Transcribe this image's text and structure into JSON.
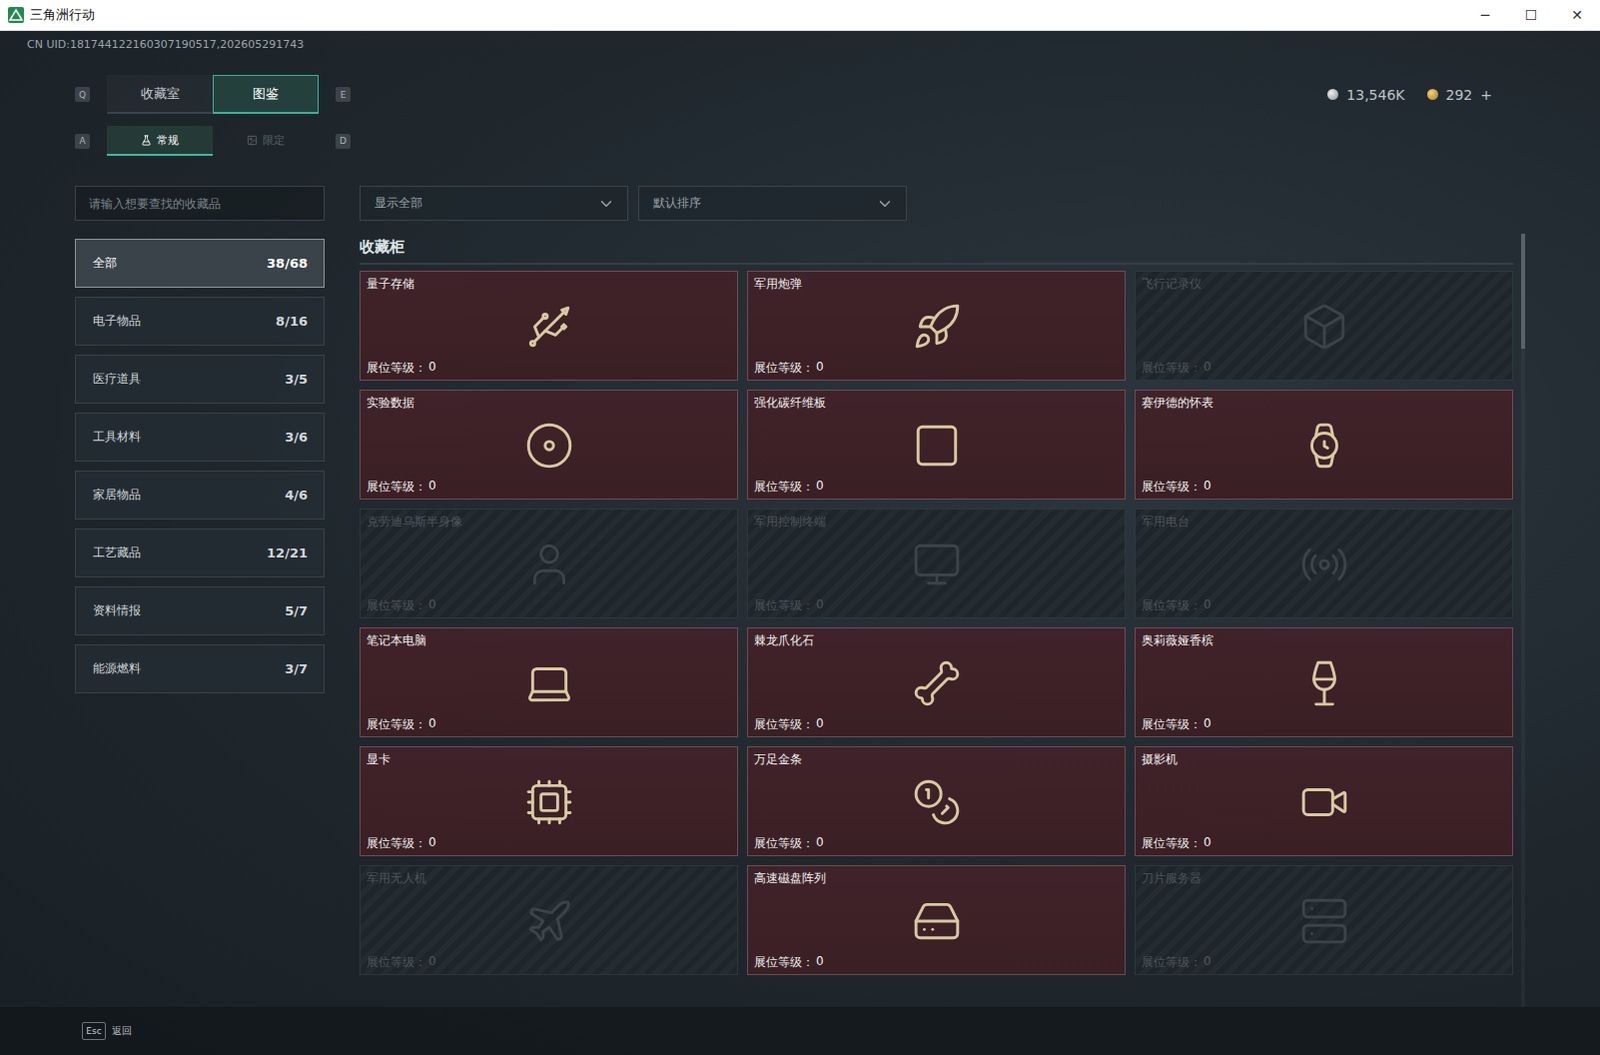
{
  "window": {
    "title": "三角洲行动",
    "controls": [
      "─",
      "☐",
      "✕"
    ]
  },
  "uid": "CN UID:181744122160307190517,202605291743",
  "currency": {
    "silver": "13,546K",
    "gold": "292",
    "add": "+"
  },
  "tab_keys": [
    "Q",
    "E"
  ],
  "tabs": [
    {
      "label": "收藏室",
      "selected": false
    },
    {
      "label": "图鉴",
      "selected": true
    }
  ],
  "subtab_keys": [
    "A",
    "D"
  ],
  "subtabs": [
    {
      "label": "常规",
      "selected": true
    },
    {
      "label": "限定",
      "selected": false
    }
  ],
  "search": {
    "placeholder": "请输入想要查找的收藏品"
  },
  "filters": [
    {
      "value": "显示全部"
    },
    {
      "value": "默认排序"
    }
  ],
  "sidebar": {
    "items": [
      {
        "label": "全部",
        "count": "38/68",
        "selected": true
      },
      {
        "label": "电子物品",
        "count": "8/16",
        "selected": false
      },
      {
        "label": "医疗道具",
        "count": "3/5",
        "selected": false
      },
      {
        "label": "工具材料",
        "count": "3/6",
        "selected": false
      },
      {
        "label": "家居物品",
        "count": "4/6",
        "selected": false
      },
      {
        "label": "工艺藏品",
        "count": "12/21",
        "selected": false
      },
      {
        "label": "资料情报",
        "count": "5/7",
        "selected": false
      },
      {
        "label": "能源燃料",
        "count": "3/7",
        "selected": false
      }
    ]
  },
  "section_title": "收藏柜",
  "items": [
    {
      "name": "量子存储",
      "owned": true,
      "level_label": "展位等级：",
      "level": "0"
    },
    {
      "name": "军用炮弹",
      "owned": true,
      "level_label": "展位等级：",
      "level": "0"
    },
    {
      "name": "飞行记录仪",
      "owned": false,
      "level_label": "展位等级：",
      "level": "0"
    },
    {
      "name": "实验数据",
      "owned": true,
      "level_label": "展位等级：",
      "level": "0"
    },
    {
      "name": "强化碳纤维板",
      "owned": true,
      "level_label": "展位等级：",
      "level": "0"
    },
    {
      "name": "赛伊德的怀表",
      "owned": true,
      "level_label": "展位等级：",
      "level": "0"
    },
    {
      "name": "克劳迪乌斯半身像",
      "owned": false,
      "level_label": "展位等级：",
      "level": "0"
    },
    {
      "name": "军用控制终端",
      "owned": false,
      "level_label": "展位等级：",
      "level": "0"
    },
    {
      "name": "军用电台",
      "owned": false,
      "level_label": "展位等级：",
      "level": "0"
    },
    {
      "name": "笔记本电脑",
      "owned": true,
      "level_label": "展位等级：",
      "level": "0"
    },
    {
      "name": "棘龙爪化石",
      "owned": true,
      "level_label": "展位等级：",
      "level": "0"
    },
    {
      "name": "奥莉薇娅香槟",
      "owned": true,
      "level_label": "展位等级：",
      "level": "0"
    },
    {
      "name": "显卡",
      "owned": true,
      "level_label": "展位等级：",
      "level": "0"
    },
    {
      "name": "万足金条",
      "owned": true,
      "level_label": "展位等级：",
      "level": "0"
    },
    {
      "name": "摄影机",
      "owned": true,
      "level_label": "展位等级：",
      "level": "0"
    },
    {
      "name": "军用无人机",
      "owned": false,
      "level_label": "展位等级：",
      "level": "0"
    },
    {
      "name": "高速磁盘阵列",
      "owned": true,
      "level_label": "展位等级：",
      "level": "0"
    },
    {
      "name": "刀片服务器",
      "owned": false,
      "level_label": "展位等级：",
      "level": "0"
    }
  ],
  "footer": {
    "key": "Esc",
    "label": "返回"
  }
}
